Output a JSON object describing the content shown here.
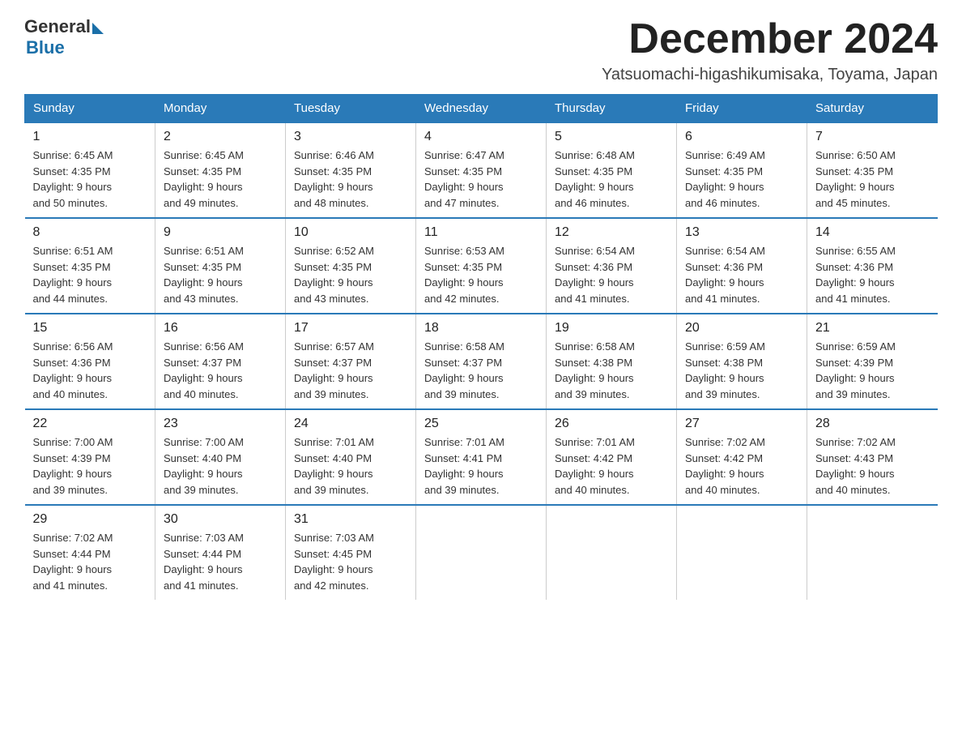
{
  "header": {
    "logo_general": "General",
    "logo_blue": "Blue",
    "title": "December 2024",
    "subtitle": "Yatsuomachi-higashikumisaka, Toyama, Japan"
  },
  "weekdays": [
    "Sunday",
    "Monday",
    "Tuesday",
    "Wednesday",
    "Thursday",
    "Friday",
    "Saturday"
  ],
  "weeks": [
    [
      {
        "day": "1",
        "sunrise": "6:45 AM",
        "sunset": "4:35 PM",
        "daylight": "9 hours and 50 minutes."
      },
      {
        "day": "2",
        "sunrise": "6:45 AM",
        "sunset": "4:35 PM",
        "daylight": "9 hours and 49 minutes."
      },
      {
        "day": "3",
        "sunrise": "6:46 AM",
        "sunset": "4:35 PM",
        "daylight": "9 hours and 48 minutes."
      },
      {
        "day": "4",
        "sunrise": "6:47 AM",
        "sunset": "4:35 PM",
        "daylight": "9 hours and 47 minutes."
      },
      {
        "day": "5",
        "sunrise": "6:48 AM",
        "sunset": "4:35 PM",
        "daylight": "9 hours and 46 minutes."
      },
      {
        "day": "6",
        "sunrise": "6:49 AM",
        "sunset": "4:35 PM",
        "daylight": "9 hours and 46 minutes."
      },
      {
        "day": "7",
        "sunrise": "6:50 AM",
        "sunset": "4:35 PM",
        "daylight": "9 hours and 45 minutes."
      }
    ],
    [
      {
        "day": "8",
        "sunrise": "6:51 AM",
        "sunset": "4:35 PM",
        "daylight": "9 hours and 44 minutes."
      },
      {
        "day": "9",
        "sunrise": "6:51 AM",
        "sunset": "4:35 PM",
        "daylight": "9 hours and 43 minutes."
      },
      {
        "day": "10",
        "sunrise": "6:52 AM",
        "sunset": "4:35 PM",
        "daylight": "9 hours and 43 minutes."
      },
      {
        "day": "11",
        "sunrise": "6:53 AM",
        "sunset": "4:35 PM",
        "daylight": "9 hours and 42 minutes."
      },
      {
        "day": "12",
        "sunrise": "6:54 AM",
        "sunset": "4:36 PM",
        "daylight": "9 hours and 41 minutes."
      },
      {
        "day": "13",
        "sunrise": "6:54 AM",
        "sunset": "4:36 PM",
        "daylight": "9 hours and 41 minutes."
      },
      {
        "day": "14",
        "sunrise": "6:55 AM",
        "sunset": "4:36 PM",
        "daylight": "9 hours and 41 minutes."
      }
    ],
    [
      {
        "day": "15",
        "sunrise": "6:56 AM",
        "sunset": "4:36 PM",
        "daylight": "9 hours and 40 minutes."
      },
      {
        "day": "16",
        "sunrise": "6:56 AM",
        "sunset": "4:37 PM",
        "daylight": "9 hours and 40 minutes."
      },
      {
        "day": "17",
        "sunrise": "6:57 AM",
        "sunset": "4:37 PM",
        "daylight": "9 hours and 39 minutes."
      },
      {
        "day": "18",
        "sunrise": "6:58 AM",
        "sunset": "4:37 PM",
        "daylight": "9 hours and 39 minutes."
      },
      {
        "day": "19",
        "sunrise": "6:58 AM",
        "sunset": "4:38 PM",
        "daylight": "9 hours and 39 minutes."
      },
      {
        "day": "20",
        "sunrise": "6:59 AM",
        "sunset": "4:38 PM",
        "daylight": "9 hours and 39 minutes."
      },
      {
        "day": "21",
        "sunrise": "6:59 AM",
        "sunset": "4:39 PM",
        "daylight": "9 hours and 39 minutes."
      }
    ],
    [
      {
        "day": "22",
        "sunrise": "7:00 AM",
        "sunset": "4:39 PM",
        "daylight": "9 hours and 39 minutes."
      },
      {
        "day": "23",
        "sunrise": "7:00 AM",
        "sunset": "4:40 PM",
        "daylight": "9 hours and 39 minutes."
      },
      {
        "day": "24",
        "sunrise": "7:01 AM",
        "sunset": "4:40 PM",
        "daylight": "9 hours and 39 minutes."
      },
      {
        "day": "25",
        "sunrise": "7:01 AM",
        "sunset": "4:41 PM",
        "daylight": "9 hours and 39 minutes."
      },
      {
        "day": "26",
        "sunrise": "7:01 AM",
        "sunset": "4:42 PM",
        "daylight": "9 hours and 40 minutes."
      },
      {
        "day": "27",
        "sunrise": "7:02 AM",
        "sunset": "4:42 PM",
        "daylight": "9 hours and 40 minutes."
      },
      {
        "day": "28",
        "sunrise": "7:02 AM",
        "sunset": "4:43 PM",
        "daylight": "9 hours and 40 minutes."
      }
    ],
    [
      {
        "day": "29",
        "sunrise": "7:02 AM",
        "sunset": "4:44 PM",
        "daylight": "9 hours and 41 minutes."
      },
      {
        "day": "30",
        "sunrise": "7:03 AM",
        "sunset": "4:44 PM",
        "daylight": "9 hours and 41 minutes."
      },
      {
        "day": "31",
        "sunrise": "7:03 AM",
        "sunset": "4:45 PM",
        "daylight": "9 hours and 42 minutes."
      },
      null,
      null,
      null,
      null
    ]
  ],
  "labels": {
    "sunrise": "Sunrise:",
    "sunset": "Sunset:",
    "daylight": "Daylight:"
  },
  "colors": {
    "header_bg": "#2a7ab8",
    "border_top": "#2a7ab8"
  }
}
